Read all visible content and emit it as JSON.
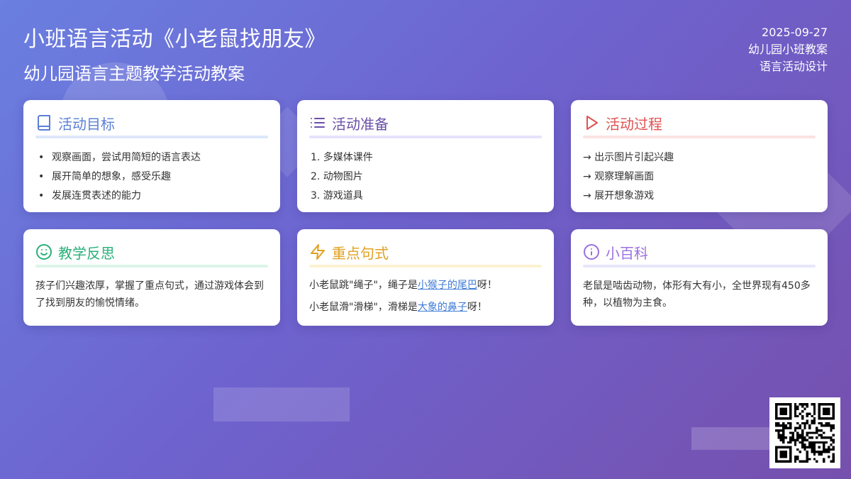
{
  "header": {
    "title": "小班语言活动《小老鼠找朋友》",
    "subtitle": "幼儿园语言主题教学活动教案"
  },
  "meta": {
    "date": "2025-09-27",
    "line2": "幼儿园小班教案",
    "line3": "语言活动设计"
  },
  "colors": {
    "blue": "#5b7fd6",
    "purple": "#6b4fa8",
    "red": "#e05252",
    "green": "#2ab07a",
    "orange": "#e0a020",
    "violet": "#9b6fe0",
    "link": "#3f7bd6"
  },
  "cards": {
    "goals": {
      "icon": "book-icon",
      "title": "活动目标",
      "items": [
        "观察画面，尝试用简短的语言表达",
        "展开简单的想象，感受乐趣",
        "发展连贯表述的能力"
      ]
    },
    "prep": {
      "icon": "list-icon",
      "title": "活动准备",
      "items": [
        "1. 多媒体课件",
        "2. 动物图片",
        "3. 游戏道具"
      ]
    },
    "process": {
      "icon": "play-icon",
      "title": "活动过程",
      "items": [
        "→ 出示图片引起兴趣",
        "→ 观察理解画面",
        "→ 展开想象游戏"
      ]
    },
    "reflection": {
      "icon": "smile-icon",
      "title": "教学反思",
      "text": "孩子们兴趣浓厚，掌握了重点句式，通过游戏体会到了找到朋友的愉悦情绪。"
    },
    "sentences": {
      "icon": "bolt-icon",
      "title": "重点句式",
      "s1": {
        "pre": "小老鼠跳\"绳子\"，绳子是",
        "link": "小猴子的尾巴",
        "post": "呀！"
      },
      "s2": {
        "pre": "小老鼠滑\"滑梯\"，滑梯是",
        "link": "大象的鼻子",
        "post": "呀！"
      }
    },
    "encyclopedia": {
      "icon": "info-icon",
      "title": "小百科",
      "text": "老鼠是啮齿动物，体形有大有小，全世界现有450多种，以植物为主食。"
    }
  },
  "qr": {
    "icon": "qr-code-icon"
  }
}
